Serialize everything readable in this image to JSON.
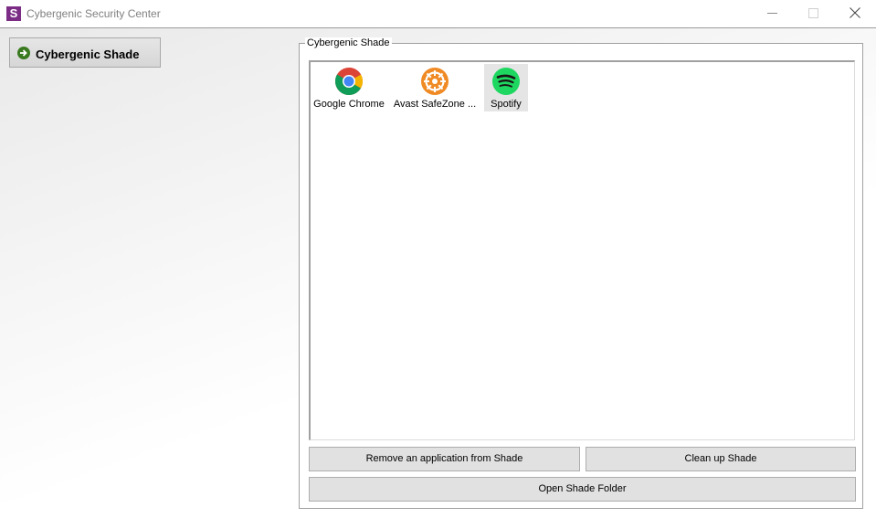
{
  "window": {
    "icon_letter": "S",
    "title": "Cybergenic Security Center"
  },
  "sidebar": {
    "items": [
      {
        "label": "Cybergenic Shade"
      }
    ]
  },
  "shade": {
    "group_title": "Cybergenic Shade",
    "apps": [
      {
        "label": "Google Chrome",
        "icon": "chrome-icon"
      },
      {
        "label": "Avast SafeZone ...",
        "icon": "avast-safezone-icon"
      },
      {
        "label": "Spotify",
        "icon": "spotify-icon",
        "selected": true
      }
    ],
    "buttons": {
      "remove": "Remove an application from Shade",
      "cleanup": "Clean up Shade",
      "open_folder": "Open Shade Folder"
    }
  },
  "colors": {
    "app_icon": "#7b2d86",
    "nav_arrow": "#3a7a1f",
    "spotify": "#1ed760",
    "avast": "#f08a24"
  }
}
